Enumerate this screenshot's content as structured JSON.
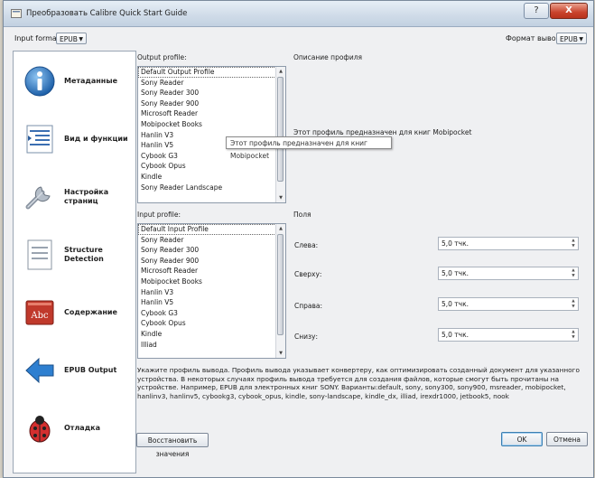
{
  "window": {
    "title": "Преобразовать Calibre Quick Start Guide",
    "controls": {
      "help": "?",
      "minimize": "–",
      "close": "X"
    }
  },
  "input_format": {
    "label": "Input format:",
    "value": "EPUB"
  },
  "output_format": {
    "label": "Формат вывода:",
    "value": "EPUB"
  },
  "sidebar": {
    "items": [
      {
        "label": "Метаданные",
        "icon": "info-icon"
      },
      {
        "label": "Вид и функции",
        "icon": "look-and-feel-icon"
      },
      {
        "label": "Настройка страниц",
        "icon": "wrench-icon"
      },
      {
        "label": "Structure Detection",
        "icon": "document-structure-icon"
      },
      {
        "label": "Содержание",
        "icon": "toc-book-icon"
      },
      {
        "label": "EPUB Output",
        "icon": "arrow-left-icon"
      },
      {
        "label": "Отладка",
        "icon": "ladybug-icon"
      }
    ]
  },
  "output_profile": {
    "label": "Output profile:",
    "items": [
      "Default Output Profile",
      "Sony Reader",
      "Sony Reader 300",
      "Sony Reader 900",
      "Microsoft Reader",
      "Mobipocket Books",
      "Hanlin V3",
      "Hanlin V5",
      "Cybook G3",
      "Cybook Opus",
      "Kindle",
      "Sony Reader Landscape"
    ],
    "selected": "Default Output Profile"
  },
  "input_profile": {
    "label": "Input profile:",
    "items": [
      "Default Input Profile",
      "Sony Reader",
      "Sony Reader 300",
      "Sony Reader 900",
      "Microsoft Reader",
      "Mobipocket Books",
      "Hanlin V3",
      "Hanlin V5",
      "Cybook G3",
      "Cybook Opus",
      "Kindle",
      "Illiad"
    ],
    "selected": "Default Input Profile"
  },
  "profile_description": {
    "label": "Описание профиля",
    "text": "Этот профиль предназначен для книг Mobipocket"
  },
  "tooltip": {
    "text": "Этот профиль предназначен для книг Mobipocket"
  },
  "margins": {
    "label": "Поля",
    "fields": [
      {
        "label": "Слева:",
        "value": "5,0 тчк."
      },
      {
        "label": "Сверху:",
        "value": "5,0 тчк."
      },
      {
        "label": "Справа:",
        "value": "5,0 тчк."
      },
      {
        "label": "Снизу:",
        "value": "5,0 тчк."
      }
    ]
  },
  "help_text": "Укажите профиль вывода. Профиль вывода указывает конвертеру, как оптимизировать созданный документ для указанного устройства. В некоторых случаях профиль вывода требуется для создания файлов, которые смогут быть прочитаны на устройстве. Например, EPUB для электронных книг SONY. Варианты:default, sony, sony300, sony900, msreader, mobipocket, hanlinv3, hanlinv5, cybookg3, cybook_opus, kindle, sony-landscape, kindle_dx, illiad, irexdr1000, jetbook5, nook",
  "buttons": {
    "restore": "Восстановить значения",
    "ok": "OK",
    "cancel": "Отмена"
  }
}
